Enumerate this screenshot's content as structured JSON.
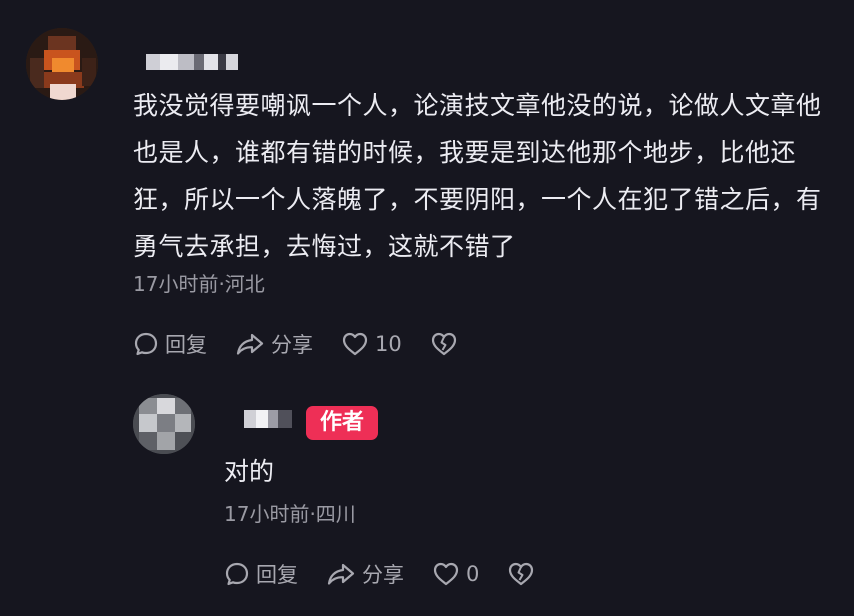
{
  "comment": {
    "text": "我没觉得要嘲讽一个人，论演技文章他没的说，论做人文章他也是人，谁都有错的时候，我要是到达他那个地步，比他还狂，所以一个人落魄了，不要阴阳，一个人在犯了错之后，有勇气去承担，去悔过，这就不错了",
    "meta": "17小时前·河北",
    "reply_label": "回复",
    "share_label": "分享",
    "like_count": "10"
  },
  "reply": {
    "badge": "作者",
    "text": "对的",
    "meta": "17小时前·四川",
    "reply_label": "回复",
    "share_label": "分享",
    "like_count": "0"
  },
  "icons": {
    "comment": "comment-bubble-icon",
    "share": "share-arrow-icon",
    "like": "heart-icon",
    "dislike": "broken-heart-icon"
  },
  "colors": {
    "background": "#16161f",
    "text": "#ececf2",
    "meta": "#9a9aa3",
    "author_badge": "#ee2f56"
  }
}
